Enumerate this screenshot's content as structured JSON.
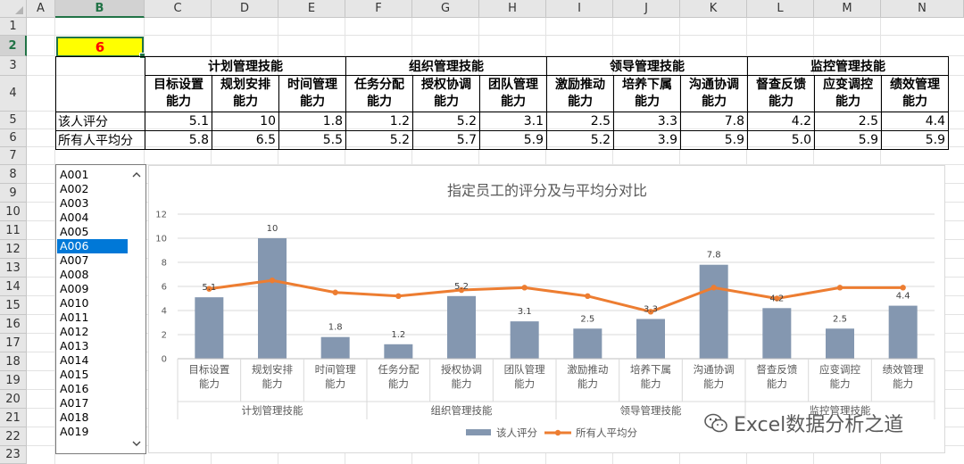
{
  "columns": [
    "A",
    "B",
    "C",
    "D",
    "E",
    "F",
    "G",
    "H",
    "I",
    "J",
    "K",
    "L",
    "M",
    "N"
  ],
  "rows": [
    "1",
    "2",
    "3",
    "4",
    "5",
    "6",
    "7",
    "8",
    "9",
    "10",
    "11",
    "12",
    "13",
    "14",
    "15",
    "16",
    "17",
    "18",
    "19",
    "20",
    "21",
    "22",
    "23"
  ],
  "selected_cell": {
    "column": "B",
    "row": "2",
    "value": "6"
  },
  "table": {
    "groups": [
      "计划管理技能",
      "组织管理技能",
      "领导管理技能",
      "监控管理技能"
    ],
    "subheaders": [
      [
        "目标设置",
        "能力"
      ],
      [
        "规划安排",
        "能力"
      ],
      [
        "时间管理",
        "能力"
      ],
      [
        "任务分配",
        "能力"
      ],
      [
        "授权协调",
        "能力"
      ],
      [
        "团队管理",
        "能力"
      ],
      [
        "激励推动",
        "能力"
      ],
      [
        "培养下属",
        "能力"
      ],
      [
        "沟通协调",
        "能力"
      ],
      [
        "督查反馈",
        "能力"
      ],
      [
        "应变调控",
        "能力"
      ],
      [
        "绩效管理",
        "能力"
      ]
    ],
    "row_labels": [
      "该人评分",
      "所有人平均分"
    ],
    "person_scores": [
      "5.1",
      "10",
      "1.8",
      "1.2",
      "5.2",
      "3.1",
      "2.5",
      "3.3",
      "7.8",
      "4.2",
      "2.5",
      "4.4"
    ],
    "avg_scores": [
      "5.8",
      "6.5",
      "5.5",
      "5.2",
      "5.7",
      "5.9",
      "5.2",
      "3.9",
      "5.9",
      "5.0",
      "5.9",
      "5.9"
    ]
  },
  "listbox": {
    "items": [
      "A001",
      "A002",
      "A003",
      "A004",
      "A005",
      "A006",
      "A007",
      "A008",
      "A009",
      "A010",
      "A011",
      "A012",
      "A013",
      "A014",
      "A015",
      "A016",
      "A017",
      "A018",
      "A019"
    ],
    "selected": "A006",
    "up_icon": "chevron-up-icon",
    "down_icon": "chevron-down-icon"
  },
  "chart_data": {
    "type": "bar",
    "title": "指定员工的评分及与平均分对比",
    "categories": [
      "目标设置\n能力",
      "规划安排\n能力",
      "时间管理\n能力",
      "任务分配\n能力",
      "授权协调\n能力",
      "团队管理\n能力",
      "激励推动\n能力",
      "培养下属\n能力",
      "沟通协调\n能力",
      "督查反馈\n能力",
      "应变调控\n能力",
      "绩效管理\n能力"
    ],
    "groups": [
      "计划管理技能",
      "组织管理技能",
      "领导管理技能",
      "监控管理技能"
    ],
    "series": [
      {
        "name": "该人评分",
        "type": "bar",
        "color": "#8497b0",
        "values": [
          5.1,
          10,
          1.8,
          1.2,
          5.2,
          3.1,
          2.5,
          3.3,
          7.8,
          4.2,
          2.5,
          4.4
        ]
      },
      {
        "name": "所有人平均分",
        "type": "line",
        "color": "#ed7d31",
        "values": [
          5.8,
          6.5,
          5.5,
          5.2,
          5.7,
          5.9,
          5.2,
          3.9,
          5.9,
          5.0,
          5.9,
          5.9
        ]
      }
    ],
    "data_labels": [
      "5.1",
      "10",
      "1.8",
      "1.2",
      "5.2",
      "3.1",
      "2.5",
      "3.3",
      "7.8",
      "4.2",
      "2.5",
      "4.4"
    ],
    "ylim": [
      0,
      12
    ],
    "yticks": [
      "0",
      "2",
      "4",
      "6",
      "8",
      "10",
      "12"
    ],
    "grid": true,
    "legend_position": "bottom"
  },
  "watermark": {
    "text": "Excel数据分析之道",
    "icon": "wechat-icon"
  }
}
